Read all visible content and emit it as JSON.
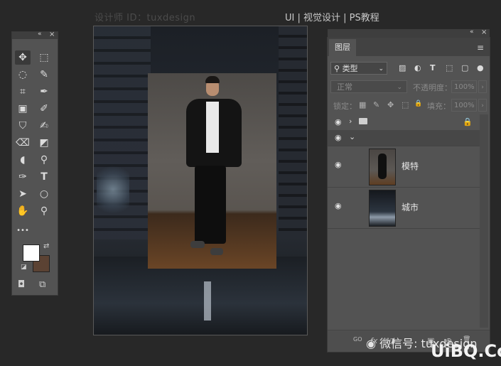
{
  "watermark": {
    "left_text": "设计师 ID：tuxdesign",
    "right_text": "UI | 视觉设计 | PS教程",
    "bottom_wechat": "微信号: tuxdesign",
    "bottom_logo": "UiBQ.CoM"
  },
  "tools_panel": {
    "collapse_label": "«",
    "close_label": "×",
    "tools": [
      {
        "name": "move",
        "glyph": "✥",
        "selected": true
      },
      {
        "name": "marquee",
        "glyph": "⬚"
      },
      {
        "name": "lasso",
        "glyph": "◌"
      },
      {
        "name": "quick-select",
        "glyph": "✎"
      },
      {
        "name": "crop",
        "glyph": "⌗"
      },
      {
        "name": "eyedropper",
        "glyph": "✒"
      },
      {
        "name": "frame",
        "glyph": "▣"
      },
      {
        "name": "brush",
        "glyph": "✐"
      },
      {
        "name": "stamp",
        "glyph": "⛉"
      },
      {
        "name": "history-brush",
        "glyph": "✍"
      },
      {
        "name": "eraser",
        "glyph": "⌫"
      },
      {
        "name": "bucket",
        "glyph": "◩"
      },
      {
        "name": "blur",
        "glyph": "◖"
      },
      {
        "name": "dodge",
        "glyph": "⚲"
      },
      {
        "name": "pen",
        "glyph": "✑"
      },
      {
        "name": "type",
        "glyph": "T"
      },
      {
        "name": "path-select",
        "glyph": "➤"
      },
      {
        "name": "ellipse",
        "glyph": "○"
      },
      {
        "name": "hand",
        "glyph": "✋"
      },
      {
        "name": "zoom",
        "glyph": "⚲"
      },
      {
        "name": "more",
        "glyph": "•••"
      }
    ],
    "swap_glyph": "⇄",
    "default_colors_glyph": "◪",
    "quick_mask_glyph": "◘",
    "screen_mode_glyph": "⧉",
    "foreground_color": "#ffffff",
    "background_color": "#5b4233"
  },
  "layers_panel": {
    "collapse_label": "«",
    "close_label": "×",
    "tab_label": "图层",
    "menu_glyph": "≡",
    "filter": {
      "selected": "类型",
      "icons": [
        "▨",
        "◐",
        "T",
        "⬚",
        "▢",
        "●"
      ]
    },
    "blend_mode": "正常",
    "opacity_label": "不透明度：",
    "opacity_value": "100%",
    "lock_label": "锁定：",
    "lock_icons": [
      "▦",
      "✎",
      "✥",
      "⬚",
      "🔒"
    ],
    "fill_label": "填充：",
    "fill_value": "100%",
    "rows": [
      {
        "type": "group",
        "expanded": false,
        "eye": "◉",
        "chev": "›",
        "locked": true
      },
      {
        "type": "group",
        "expanded": true,
        "eye": "◉",
        "chev": "⌄"
      },
      {
        "type": "layer",
        "name": "模特",
        "eye": "◉"
      },
      {
        "type": "layer",
        "name": "城市",
        "eye": "◉"
      }
    ],
    "bottom_icons": [
      "GO",
      "fx",
      "◑",
      "▣",
      "⊕",
      "🗑"
    ]
  }
}
